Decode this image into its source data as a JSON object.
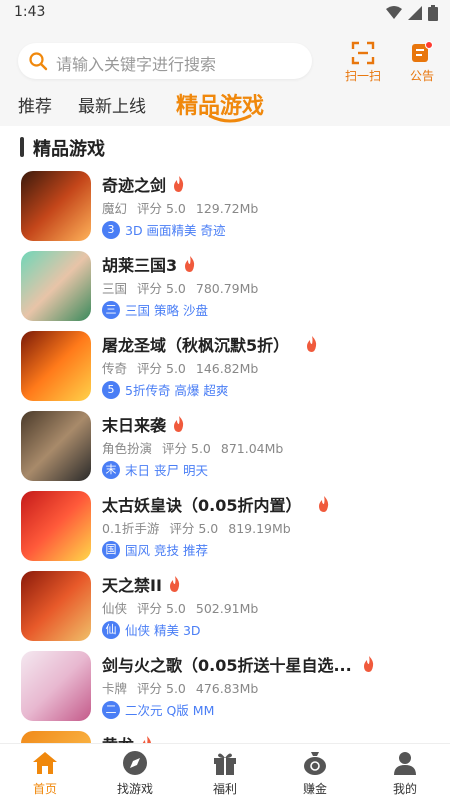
{
  "status_bar": {
    "time": "1:43"
  },
  "search": {
    "placeholder": "请输入关键字进行搜索"
  },
  "top_buttons": {
    "scan_label": "扫一扫",
    "notice_label": "公告"
  },
  "tabs": [
    {
      "label": "推荐"
    },
    {
      "label": "最新上线"
    },
    {
      "label": "精品游戏"
    }
  ],
  "section": {
    "title": "精品游戏"
  },
  "games": [
    {
      "name": "奇迹之剑",
      "category": "魔幻",
      "rating": "评分 5.0",
      "size": "129.72Mb",
      "badge": "3",
      "tags": "3D 画面精美 奇迹"
    },
    {
      "name": "胡莱三国3",
      "category": "三国",
      "rating": "评分 5.0",
      "size": "780.79Mb",
      "badge": "三",
      "tags": "三国 策略 沙盘"
    },
    {
      "name": "屠龙圣域（秋枫沉默5折）",
      "category": "传奇",
      "rating": "评分 5.0",
      "size": "146.82Mb",
      "badge": "5",
      "tags": "5折传奇 高爆 超爽"
    },
    {
      "name": "末日来袭",
      "category": "角色扮演",
      "rating": "评分 5.0",
      "size": "871.04Mb",
      "badge": "末",
      "tags": "末日 丧尸 明天"
    },
    {
      "name": "太古妖皇诀（0.05折内置）",
      "category": "0.1折手游",
      "rating": "评分 5.0",
      "size": "819.19Mb",
      "badge": "国",
      "tags": "国风 竞技 推荐"
    },
    {
      "name": "天之禁II",
      "category": "仙侠",
      "rating": "评分 5.0",
      "size": "502.91Mb",
      "badge": "仙",
      "tags": "仙侠 精美 3D"
    },
    {
      "name": "剑与火之歌（0.05折送十星自选...",
      "category": "卡牌",
      "rating": "评分 5.0",
      "size": "476.83Mb",
      "badge": "二",
      "tags": "二次元 Q版 MM"
    },
    {
      "name": "黄龙",
      "category": "",
      "rating": "",
      "size": "",
      "badge": "",
      "tags": ""
    }
  ],
  "bottom_nav": [
    {
      "label": "首页"
    },
    {
      "label": "找游戏"
    },
    {
      "label": "福利"
    },
    {
      "label": "赚金"
    },
    {
      "label": "我的"
    }
  ],
  "colors": {
    "accent": "#f0880c",
    "tag_blue": "#4a7ef5",
    "hot_red": "#f05a3c"
  }
}
